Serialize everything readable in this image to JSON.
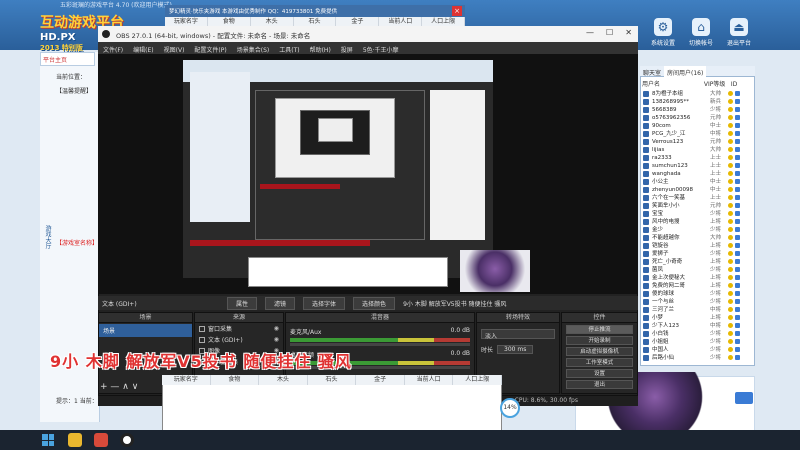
{
  "lobby": {
    "title": "五彩斑斓的游戏平台 4.70 (欢迎用户模式)",
    "logo_text": "互动游戏平台",
    "logo_sub": "HD.PX",
    "logo_year": "2013 特别版",
    "icons": [
      {
        "label": "系统设置",
        "icon": "gear-icon",
        "glyph": "⚙"
      },
      {
        "label": "切换帐号",
        "icon": "switch-account-icon",
        "glyph": "⌂"
      },
      {
        "label": "退出平台",
        "icon": "exit-icon",
        "glyph": "⏏"
      }
    ],
    "sidebar_tab": "平台主页",
    "side_label": "游戏大厅",
    "position_text": "当前位置：",
    "notice_text": "【温馨提醒】",
    "red_note": "【游戏室名称】",
    "hint_text": "提示：1 当前：",
    "speed": "14%"
  },
  "userlist": {
    "tabs": [
      "聊天室",
      "房间用户(16)"
    ],
    "headers": [
      "用户名",
      "VIP等级",
      "ID"
    ],
    "users": [
      {
        "name": "8为橙子本组",
        "level": "大帅"
      },
      {
        "name": "138268995**",
        "level": "新兵"
      },
      {
        "name": "5668389",
        "level": "少将"
      },
      {
        "name": "o5763962356",
        "level": "元帅"
      },
      {
        "name": "90com",
        "level": "中士"
      },
      {
        "name": "PCG_九少_江",
        "level": "中将"
      },
      {
        "name": "Verrous123",
        "level": "元帅"
      },
      {
        "name": "lijias",
        "level": "大帅"
      },
      {
        "name": "ra2333",
        "level": "上士"
      },
      {
        "name": "sumchun123",
        "level": "上士"
      },
      {
        "name": "wanghada",
        "level": "上士"
      },
      {
        "name": "小公主",
        "level": "中士"
      },
      {
        "name": "zhenyun00098",
        "level": "中士"
      },
      {
        "name": "六个在一笑基",
        "level": "上士"
      },
      {
        "name": "笑面芈小小",
        "level": "元帅"
      },
      {
        "name": "宝宝",
        "level": "少将"
      },
      {
        "name": "风中的电搜",
        "level": "上将"
      },
      {
        "name": "金少",
        "level": "少将"
      },
      {
        "name": "不能超越你",
        "level": "大帅"
      },
      {
        "name": "铠旋谷",
        "level": "上将"
      },
      {
        "name": "爱狮子",
        "level": "少将"
      },
      {
        "name": "死亡_小奇奇",
        "level": "上将"
      },
      {
        "name": "菌凤",
        "level": "少将"
      },
      {
        "name": "金上次便秘大",
        "level": "上将"
      },
      {
        "name": "免费的网二哥",
        "level": "上将"
      },
      {
        "name": "傻的球球",
        "level": "少将"
      },
      {
        "name": "一个与丝",
        "level": "少将"
      },
      {
        "name": "三河了兰",
        "level": "中将"
      },
      {
        "name": "小梦",
        "level": "上将"
      },
      {
        "name": "少下人123",
        "level": "中将"
      },
      {
        "name": "小白钱",
        "level": "少将"
      },
      {
        "name": "小姐姐",
        "level": "少将"
      },
      {
        "name": "中国人",
        "level": "少将"
      },
      {
        "name": "后路小仙",
        "level": "少将"
      }
    ]
  },
  "subwin": {
    "title": "梦幻精灵·快乐夹游戏 本游戏由优秀制作 QQ：419733801 免费提供",
    "columns": [
      "玩家名字",
      "食物",
      "木头",
      "石头",
      "金子",
      "当前人口",
      "人口上限"
    ],
    "close": "×"
  },
  "obs": {
    "title": "OBS 27.0.1 (64-bit, windows) - 配置文件: 未命名 - 场景: 未命名",
    "winbtns": [
      "—",
      "☐",
      "✕"
    ],
    "menu": [
      "文件(F)",
      "编辑(E)",
      "视图(V)",
      "配置文件(P)",
      "场景集合(S)",
      "工具(T)",
      "帮助(H)",
      "投屏",
      "5色·千王小摩"
    ],
    "source_label": "文本 (GDI+)",
    "source_buttons": [
      "属性",
      "滤镜",
      "选择字体",
      "选择颜色"
    ],
    "ticker": "9小 木脚 解放军V5投书 随便挂住 骚风",
    "docks": {
      "scenes": {
        "title": "场景",
        "items": [
          "场景"
        ]
      },
      "sources": {
        "title": "来源",
        "items": [
          "窗口采集",
          "文本 (GDI+)",
          "图像",
          "显示器采集"
        ]
      },
      "mixer": {
        "title": "混音器",
        "tracks": [
          {
            "name": "麦克风/Aux",
            "db": "0.0 dB"
          },
          {
            "name": "桌面音频",
            "db": "0.0 dB"
          }
        ]
      },
      "transitions": {
        "title": "转场特效",
        "selected": "淡入",
        "duration_label": "时长",
        "duration": "300 ms"
      },
      "controls": {
        "title": "控件",
        "buttons": [
          "停止推流",
          "开始录制",
          "启动虚拟摄像机",
          "工作室模式",
          "设置",
          "退出"
        ]
      }
    },
    "tools": "+ — ∧ ∨",
    "status": "CPU: 8.6%, 30.00 fps"
  },
  "overlay_text": "9小 木脚 解放军V5投书 随便挂住 骚风",
  "bottom_list": {
    "columns": [
      "玩家名字",
      "食物",
      "木头",
      "石头",
      "金子",
      "当前人口",
      "人口上限"
    ]
  },
  "taskbar": {
    "icons": [
      "start-icon",
      "browser-icon",
      "game-icon",
      "obs-icon"
    ]
  }
}
